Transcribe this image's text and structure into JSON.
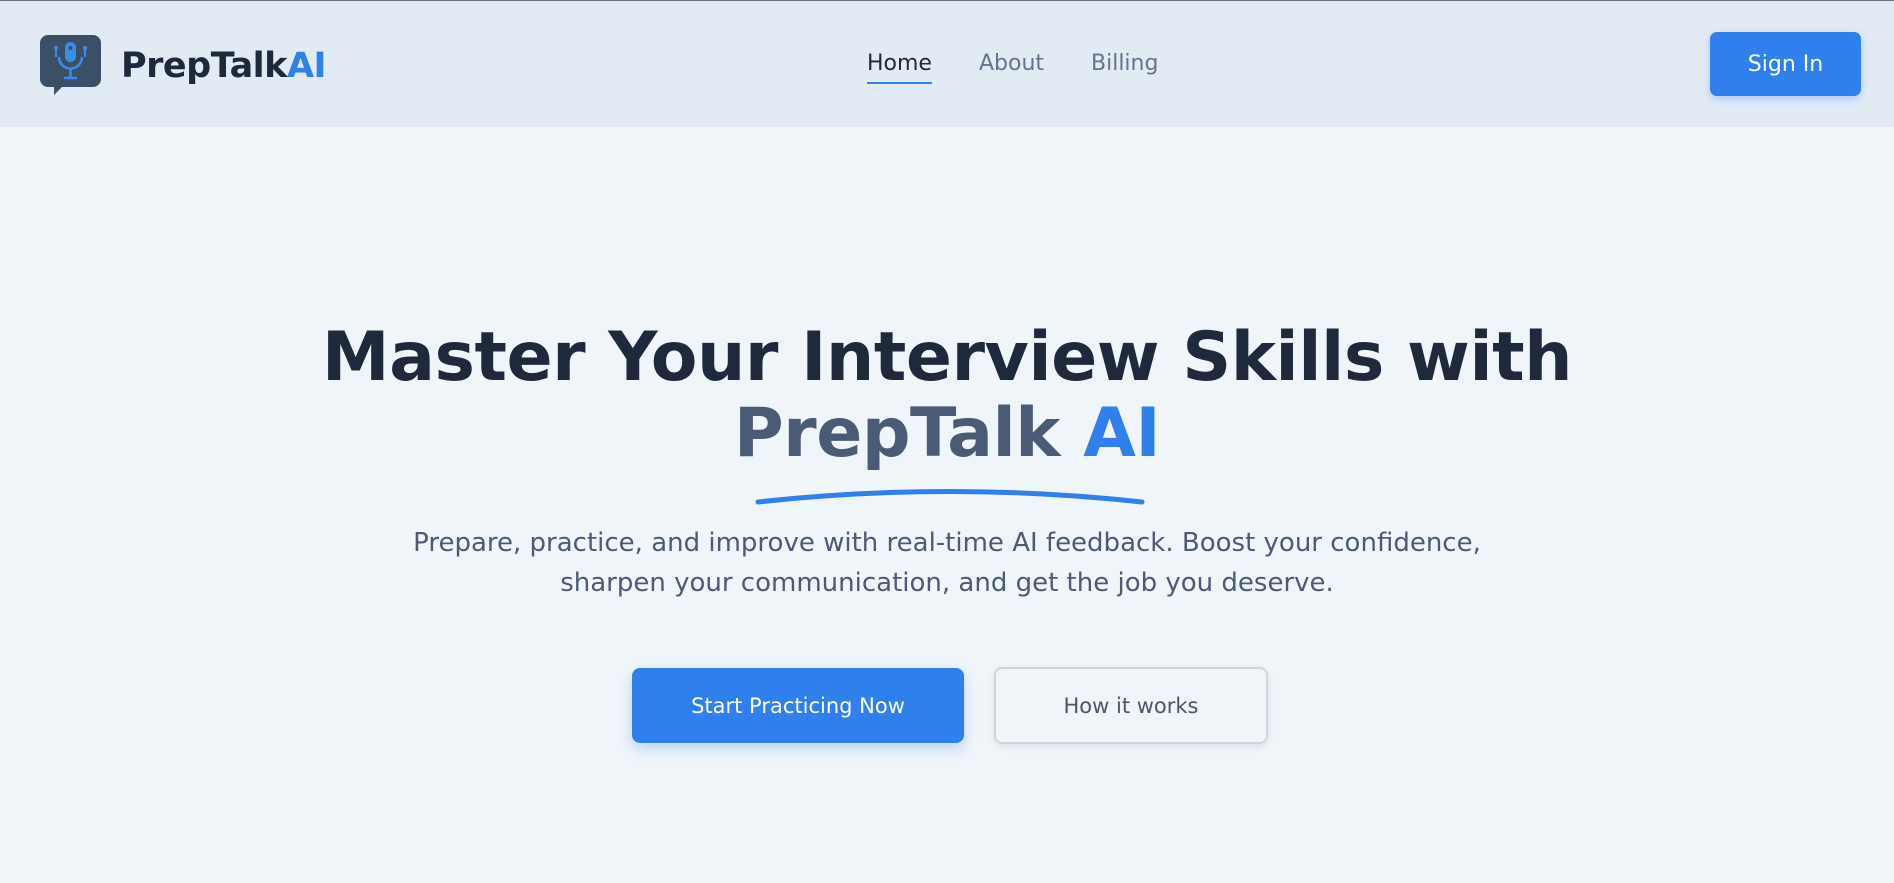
{
  "brand": {
    "name_main": "PrepTalk",
    "name_accent": "AI",
    "logo_icon": "microphone-chat-icon"
  },
  "nav": {
    "items": [
      {
        "label": "Home",
        "active": true
      },
      {
        "label": "About",
        "active": false
      },
      {
        "label": "Billing",
        "active": false
      }
    ],
    "signin_label": "Sign In"
  },
  "hero": {
    "headline_line1": "Master Your Interview Skills with",
    "headline_brand": "PrepTalk",
    "headline_ai": "AI",
    "subtext": "Prepare, practice, and improve with real-time AI feedback. Boost your confidence, sharpen your communication, and get the job you deserve.",
    "primary_cta": "Start Practicing Now",
    "secondary_cta": "How it works"
  },
  "colors": {
    "accent": "#2f80ed",
    "dark_text": "#1e293b",
    "muted_text": "#4b5b75",
    "nav_bg": "#e2ebf4",
    "page_bg": "#f0f5fa"
  }
}
